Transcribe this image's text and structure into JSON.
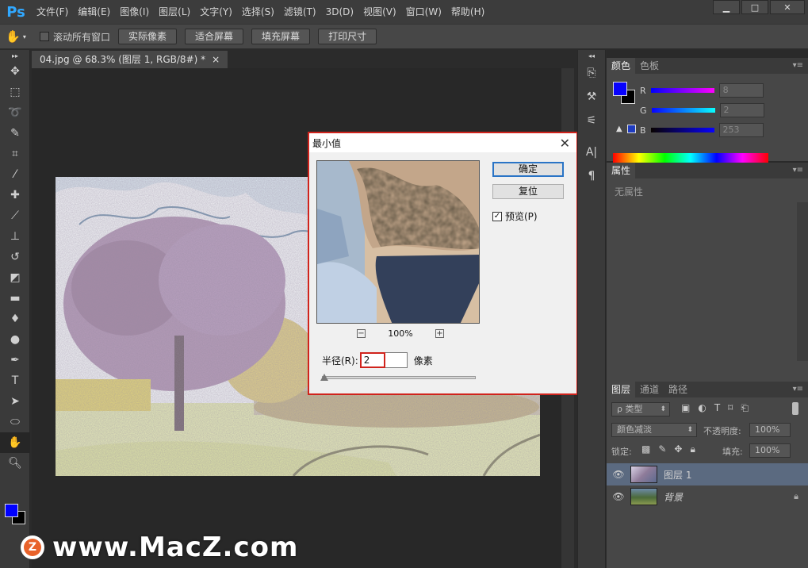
{
  "app": {
    "logo": "Ps"
  },
  "menu": [
    "文件(F)",
    "编辑(E)",
    "图像(I)",
    "图层(L)",
    "文字(Y)",
    "选择(S)",
    "滤镜(T)",
    "3D(D)",
    "视图(V)",
    "窗口(W)",
    "帮助(H)"
  ],
  "window_controls": {
    "minimize": "▁",
    "maximize": "□",
    "close": "✕"
  },
  "options": {
    "scroll_all_label": "滚动所有窗口",
    "buttons": [
      "实际像素",
      "适合屏幕",
      "填充屏幕",
      "打印尺寸"
    ]
  },
  "document": {
    "tab_title": "04.jpg @ 68.3% (图层 1, RGB/8#) *",
    "tab_close": "×"
  },
  "dialog": {
    "title": "最小值",
    "close": "✕",
    "ok": "确定",
    "reset": "复位",
    "preview_label": "预览(P)",
    "preview_checked": "✓",
    "zoom": "100%",
    "zoom_out": "−",
    "zoom_in": "+",
    "radius_label": "半径(R):",
    "radius_value": "2",
    "radius_unit": "像素",
    "slider_value": 2
  },
  "color_panel": {
    "tabs": [
      "颜色",
      "色板"
    ],
    "channels": [
      {
        "label": "R",
        "value": "8"
      },
      {
        "label": "G",
        "value": "2"
      },
      {
        "label": "B",
        "value": "253"
      }
    ],
    "fg_color": "#0802fd",
    "warning": "▲"
  },
  "properties_panel": {
    "tab": "属性",
    "empty_text": "无属性"
  },
  "layers_panel": {
    "tabs": [
      "图层",
      "通道",
      "路径"
    ],
    "filter_label": "ρ 类型",
    "blend_mode": "颜色减淡",
    "opacity_label": "不透明度:",
    "opacity_value": "100%",
    "lock_label": "锁定:",
    "fill_label": "填充:",
    "fill_value": "100%",
    "layers": [
      {
        "name": "图层 1",
        "selected": true
      },
      {
        "name": "背景",
        "selected": false
      }
    ]
  },
  "watermark": {
    "logo": "Z",
    "text": "www.MacZ.com"
  }
}
